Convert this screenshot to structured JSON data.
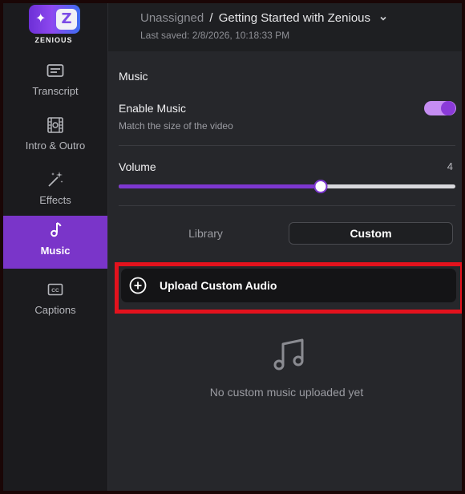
{
  "brand": {
    "name": "ZENIOUS",
    "badge_letter": "Z"
  },
  "sidebar": {
    "items": [
      {
        "label": "Transcript",
        "icon": "transcript-icon",
        "active": false
      },
      {
        "label": "Intro & Outro",
        "icon": "film-icon",
        "active": false
      },
      {
        "label": "Effects",
        "icon": "magic-wand-icon",
        "active": false
      },
      {
        "label": "Music",
        "icon": "music-note-icon",
        "active": true
      },
      {
        "label": "Captions",
        "icon": "captions-icon",
        "active": false
      }
    ]
  },
  "header": {
    "folder": "Unassigned",
    "separator": "/",
    "project": "Getting Started with Zenious",
    "last_saved": "Last saved: 2/8/2026, 10:18:33 PM"
  },
  "music": {
    "section_title": "Music",
    "enable_label": "Enable Music",
    "enable_sub": "Match the size of the video",
    "enabled": true,
    "volume_label": "Volume",
    "volume_value": "4",
    "volume_fraction": 0.6,
    "tabs": [
      {
        "label": "Library",
        "selected": false
      },
      {
        "label": "Custom",
        "selected": true
      }
    ],
    "upload_label": "Upload Custom Audio",
    "empty_text": "No custom music uploaded yet"
  },
  "colors": {
    "accent": "#7a35c9",
    "highlight": "#e3121d"
  }
}
